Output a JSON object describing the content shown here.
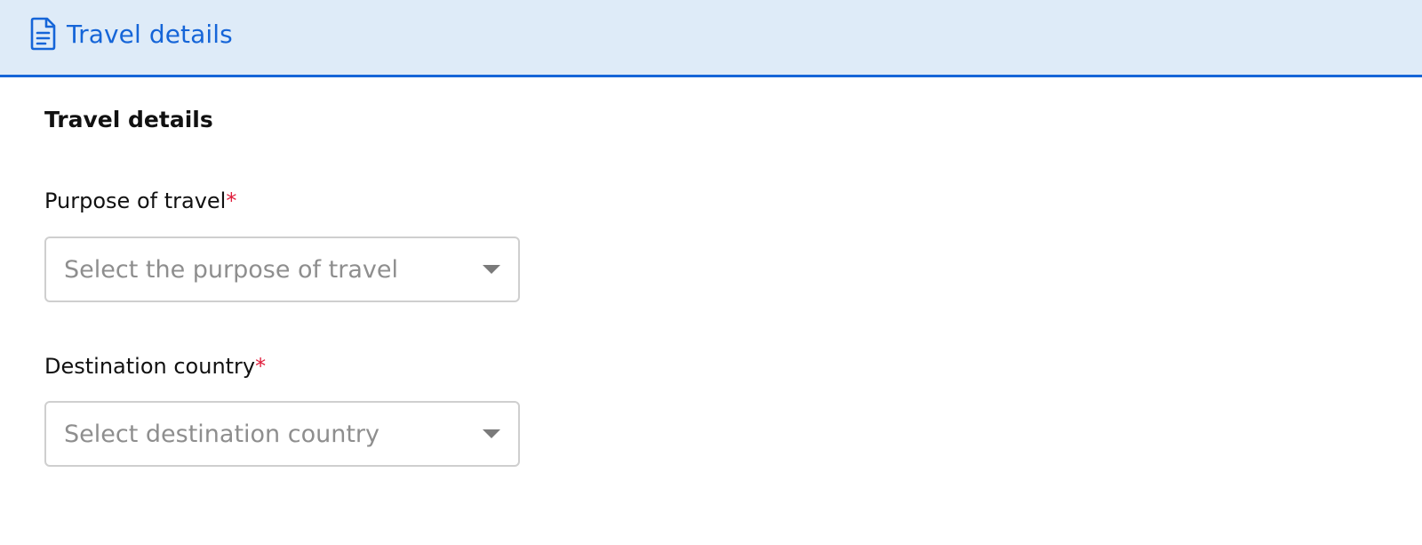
{
  "header": {
    "title": "Travel details",
    "icon": "document-icon",
    "accent_color": "#1565d8",
    "background_color": "#deebf8"
  },
  "section": {
    "title": "Travel details"
  },
  "fields": [
    {
      "label": "Purpose of travel",
      "required_mark": "*",
      "placeholder": "Select the purpose of travel"
    },
    {
      "label": "Destination country",
      "required_mark": "*",
      "placeholder": "Select destination country"
    }
  ]
}
